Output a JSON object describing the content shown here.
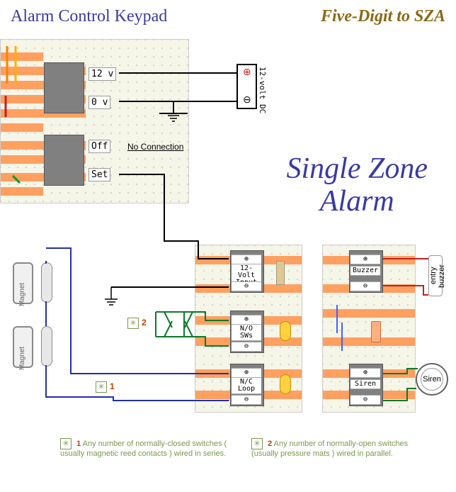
{
  "titles": {
    "left": "Alarm Control Keypad",
    "right": "Five-Digit to SZA",
    "main_line1": "Single Zone",
    "main_line2": "Alarm"
  },
  "terminals": {
    "t12v": "12 v",
    "t0v": "0 v",
    "off": "Off",
    "set": "Set",
    "no_connection": "No Connection",
    "volt_input_l1": "12-Volt",
    "volt_input_l2": "Input",
    "no_sws_l1": "N/O",
    "no_sws_l2": "SWs",
    "nc_loop_l1": "N/C",
    "nc_loop_l2": "Loop",
    "buzzer": "Buzzer",
    "siren": "Siren"
  },
  "power": {
    "dc_label": "12-volt DC",
    "plus": "+",
    "minus": "−"
  },
  "magnets": {
    "label": "Magnet"
  },
  "siren": {
    "label": "Siren"
  },
  "entry_buzzer": "entry buzzer",
  "footnotes": {
    "f1_num": "1",
    "f1_text": "Any number of normally-closed switches ( usually magnetic reed contacts ) wired in series.",
    "f2_num": "2",
    "f2_text": "Any number of normally-open switches (usually pressure mats ) wired in parallel."
  },
  "markers": {
    "star": "✳",
    "m1": "1",
    "m2": "2"
  },
  "symbols": {
    "plus_circ": "⊕",
    "minus_circ": "⊖"
  },
  "chart_data": {
    "type": "table",
    "description": "Electronic circuit wiring diagram: Five-Digit Alarm Control Keypad connected to Single Zone Alarm (SZA)",
    "modules": [
      {
        "name": "Alarm Control Keypad",
        "terminals": [
          "12 v",
          "0 v",
          "Off (No Connection)",
          "Set"
        ]
      },
      {
        "name": "Single Zone Alarm (left board)",
        "terminals": [
          "12-Volt Input (+/−)",
          "N/O SWs (+/−)",
          "N/C Loop (+/−)"
        ]
      },
      {
        "name": "Single Zone Alarm (right board)",
        "terminals": [
          "Buzzer (+/−)",
          "Siren (+/−)"
        ]
      }
    ],
    "external_components": [
      {
        "name": "12-volt DC power supply",
        "connects_to": [
          "Keypad 12v/0v",
          "SZA 12-Volt Input"
        ]
      },
      {
        "name": "Magnetic reed switches (normally-closed, series)",
        "connects_to": "N/C Loop",
        "footnote": 1
      },
      {
        "name": "Pressure-mat switches (normally-open, parallel)",
        "connects_to": "N/O SWs",
        "footnote": 2
      },
      {
        "name": "Entry buzzer",
        "connects_to": "Buzzer +/−"
      },
      {
        "name": "Siren",
        "connects_to": "Siren +/−"
      }
    ],
    "connections": [
      {
        "from": "Keypad 12v",
        "to": "DC +"
      },
      {
        "from": "Keypad 0v",
        "to": "DC − / Ground"
      },
      {
        "from": "Keypad Set",
        "to": "SZA 12-Volt Input +"
      },
      {
        "from": "Ground",
        "to": "SZA 12-Volt Input −"
      },
      {
        "from": "Reed contacts (series loop)",
        "to": "SZA N/C Loop"
      },
      {
        "from": "N/O switches (parallel)",
        "to": "SZA N/O SWs"
      },
      {
        "from": "SZA Buzzer",
        "to": "entry buzzer"
      },
      {
        "from": "SZA Siren",
        "to": "Siren"
      }
    ],
    "footnotes": [
      {
        "id": 1,
        "text": "Any number of normally-closed switches (usually magnetic reed contacts) wired in series."
      },
      {
        "id": 2,
        "text": "Any number of normally-open switches (usually pressure mats) wired in parallel."
      }
    ]
  }
}
